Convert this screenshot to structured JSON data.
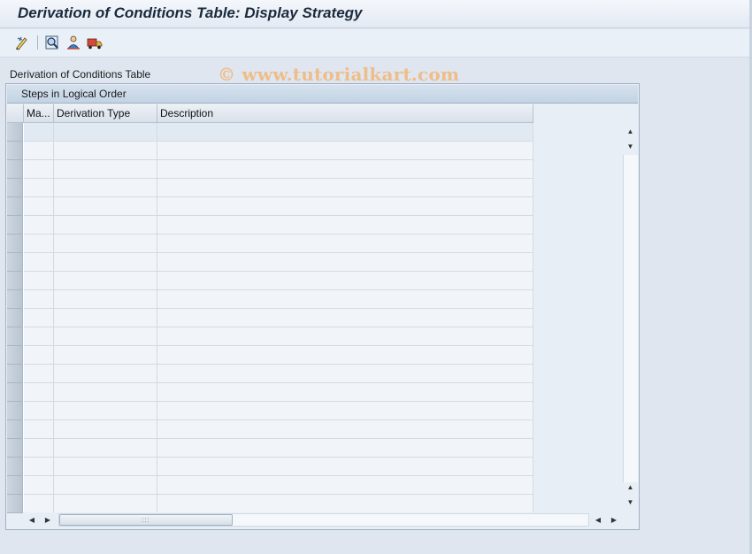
{
  "title": "Derivation of Conditions Table: Display Strategy",
  "toolbar": {
    "icons": [
      "display-change-icon",
      "find-icon",
      "user-icon",
      "transport-icon"
    ]
  },
  "watermark": "© www.tutorialkart.com",
  "section_label": "Derivation of Conditions Table",
  "panel": {
    "title": "Steps in Logical Order",
    "columns": [
      "Ma...",
      "Derivation Type",
      "Description"
    ],
    "visible_rows": 21
  },
  "colors": {
    "title_text": "#1a2a3d",
    "background": "#dfe6ef",
    "watermark": "#efbd8a"
  }
}
